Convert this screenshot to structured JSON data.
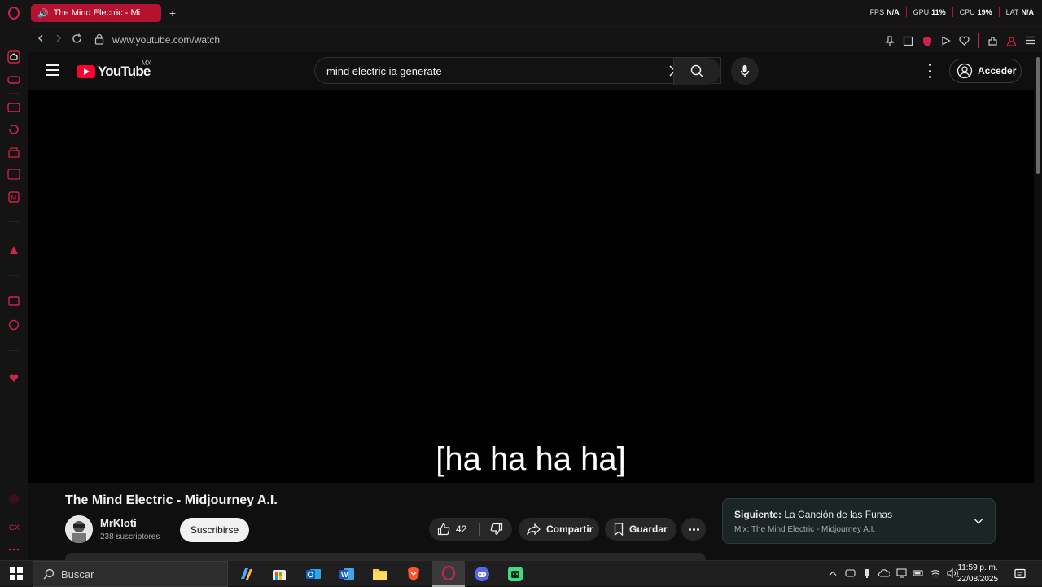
{
  "browser": {
    "tab_title": "The Mind Electric - Mi",
    "url": "www.youtube.com/watch",
    "stats": [
      {
        "label": "FPS",
        "value": "N/A"
      },
      {
        "label": "GPU",
        "value": "11%"
      },
      {
        "label": "CPU",
        "value": "19%"
      },
      {
        "label": "LAT",
        "value": "N/A"
      }
    ],
    "accent_color": "#d0214a"
  },
  "youtube": {
    "logo_text": "YouTube",
    "country_code": "MX",
    "search_query": "mind electric ia generate",
    "signin_label": "Acceder",
    "caption": "[ha ha ha ha]",
    "video_title": "The Mind Electric - Midjourney A.I.",
    "channel_name": "MrKloti",
    "subscriber_count": "238 suscriptores",
    "subscribe_label": "Suscribirse",
    "like_count": "42",
    "share_label": "Compartir",
    "save_label": "Guardar",
    "next": {
      "prefix": "Siguiente:",
      "title": "La Canción de las Funas",
      "subtitle": "Mix: The Mind Electric - Midjourney A.I."
    }
  },
  "taskbar": {
    "search_placeholder": "Buscar",
    "time": "11:59 p. m.",
    "date": "22/08/2025"
  }
}
